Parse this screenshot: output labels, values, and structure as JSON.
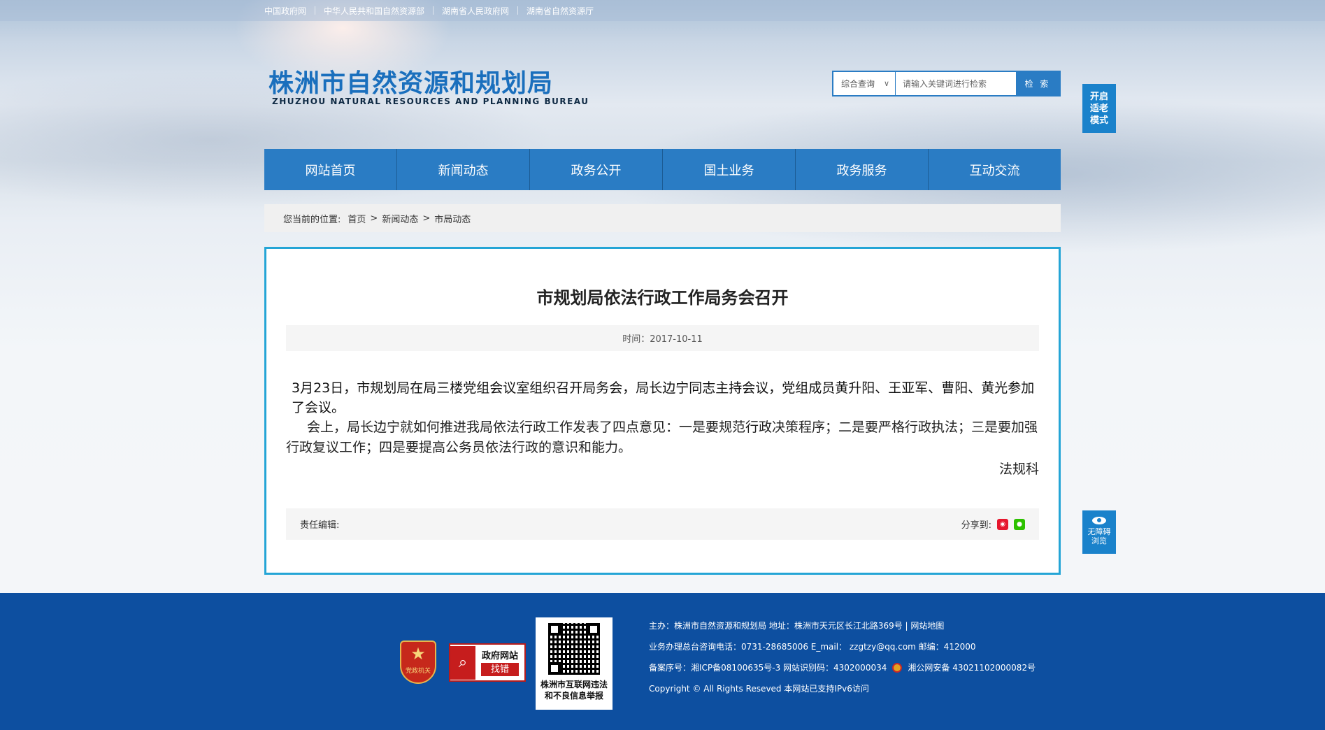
{
  "top_links": [
    "中国政府网",
    "中华人民共和国自然资源部",
    "湖南省人民政府网",
    "湖南省自然资源厅"
  ],
  "logo": {
    "cn": "株洲市自然资源和规划局",
    "en": "ZHUZHOU NATURAL RESOURCES AND PLANNING BUREAU"
  },
  "search": {
    "scope": "综合查询",
    "placeholder": "请输入关键词进行检索",
    "button": "检 索"
  },
  "elder_mode": "开启适老模式",
  "accessibility": "无障碍浏览",
  "nav": [
    "网站首页",
    "新闻动态",
    "政务公开",
    "国土业务",
    "政务服务",
    "互动交流"
  ],
  "breadcrumb": {
    "prefix": "您当前的位置:",
    "items": [
      "首页",
      "新闻动态",
      "市局动态"
    ],
    "separator": ">"
  },
  "article": {
    "title": "市规划局依法行政工作局务会召开",
    "time": "时间：2017-10-11",
    "paragraphs": [
      "3月23日，市规划局在局三楼党组会议室组织召开局务会，局长边宁同志主持会议，党组成员黄升阳、王亚军、曹阳、黄光参加了会议。",
      "会上，局长边宁就如何推进我局依法行政工作发表了四点意见：一是要规范行政决策程序；二是要严格行政执法；三是要加强行政复议工作；四是要提高公务员依法行政的意识和能力。",
      "法规科"
    ],
    "editor": "责任编辑:",
    "share": "分享到:"
  },
  "footer": {
    "party_badge": "党政机关",
    "gov_badge": {
      "line1": "政府网站",
      "line2": "找错"
    },
    "qr_caption": [
      "株洲市互联网违法",
      "和不良信息举报"
    ],
    "lines": [
      "主办：株洲市自然资源和规划局   地址：株洲市天元区长江北路369号  |  网站地图",
      "业务办理总台咨询电话：0731-28685006    E_mail：  zzgtzy@qq.com     邮编：412000",
      "备案序号：湘ICP备08100635号-3 网站识别码：4302000034",
      "湘公网安备 43021102000082号",
      "Copyright © All Rights Reseved 本网站已支持IPv6访问"
    ]
  },
  "colors": {
    "primary": "#2a7cc4",
    "border": "#24a5d6",
    "footer_bg": "#0d4fa0",
    "title_blue": "#1a6fbd"
  }
}
